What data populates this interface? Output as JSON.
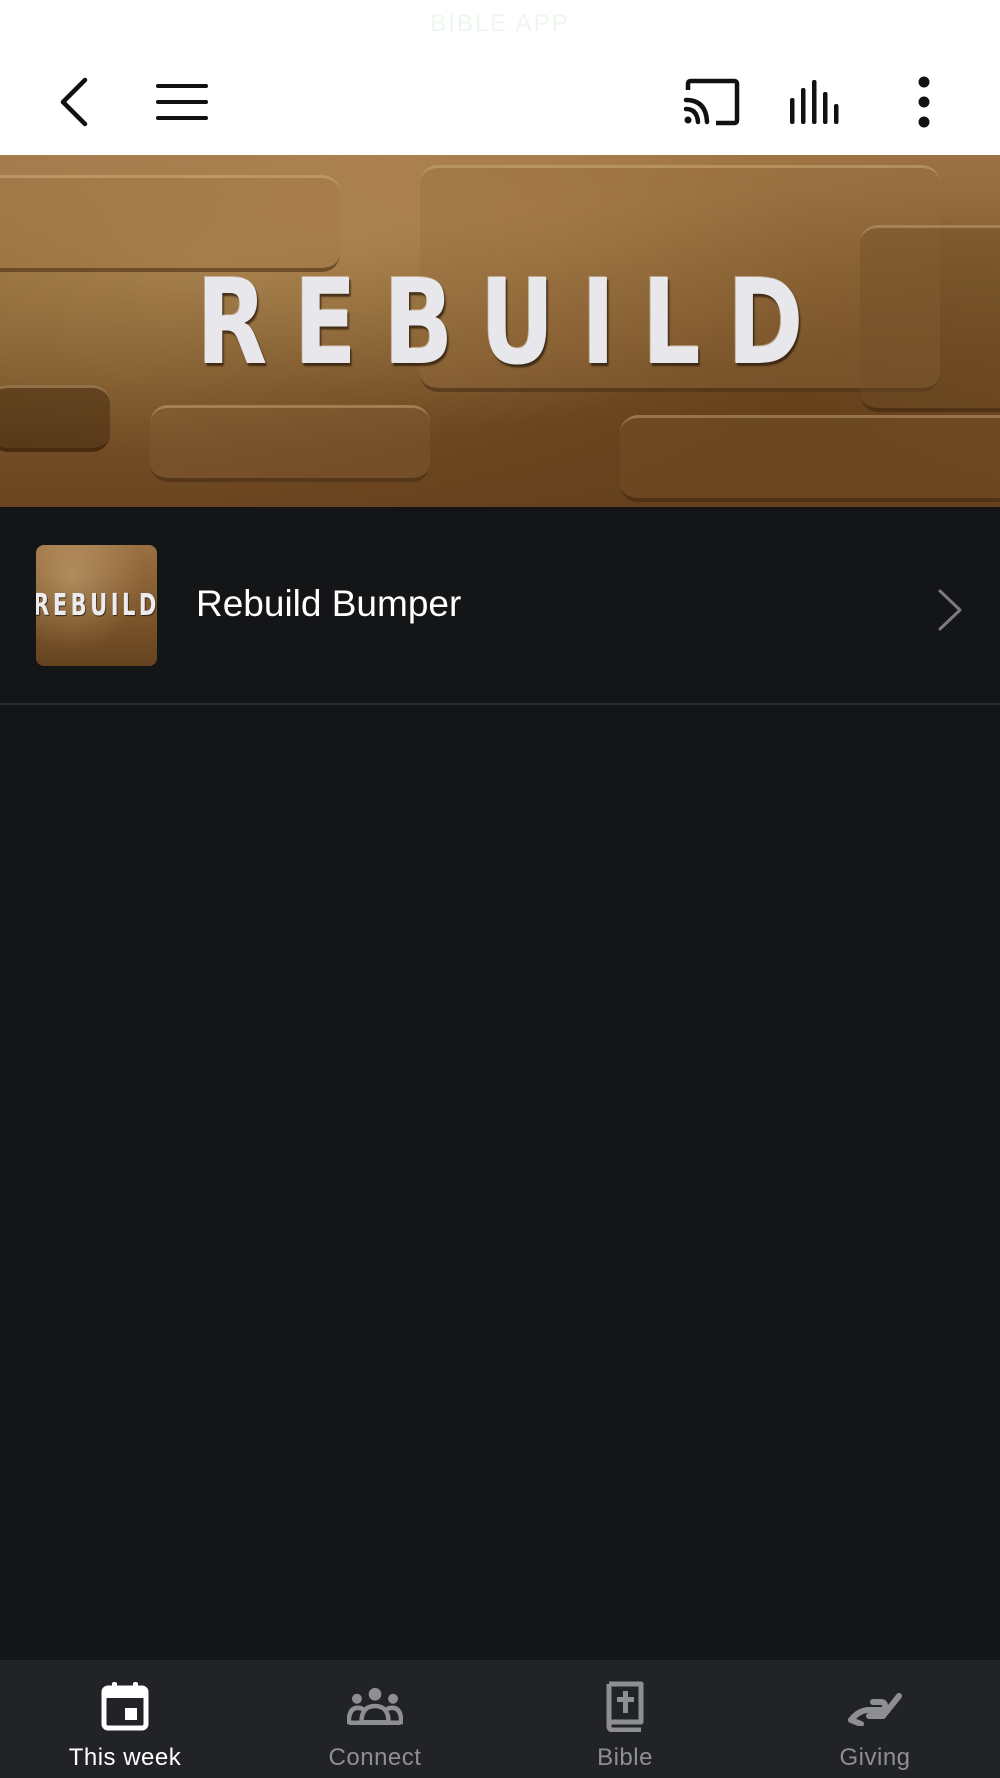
{
  "status_bar": {
    "text": "BIBLE APP"
  },
  "toolbar": {
    "back_icon": "chevron-left-icon",
    "menu_icon": "hamburger-menu-icon",
    "cast_icon": "cast-icon",
    "audio_icon": "equalizer-bars-icon",
    "more_icon": "vertical-dots-icon"
  },
  "hero": {
    "title": "REBUILD"
  },
  "list": {
    "items": [
      {
        "thumb_text": "REBUILD",
        "title": "Rebuild Bumper"
      }
    ]
  },
  "bottom_nav": {
    "tabs": [
      {
        "label": "This week",
        "icon": "calendar-icon",
        "active": true
      },
      {
        "label": "Connect",
        "icon": "people-group-icon",
        "active": false
      },
      {
        "label": "Bible",
        "icon": "bible-book-icon",
        "active": false
      },
      {
        "label": "Giving",
        "icon": "hand-giving-icon",
        "active": false
      }
    ]
  },
  "colors": {
    "background": "#141517",
    "nav_background": "#222326",
    "active_label": "#ffffff",
    "inactive_label": "#8e8f94"
  }
}
